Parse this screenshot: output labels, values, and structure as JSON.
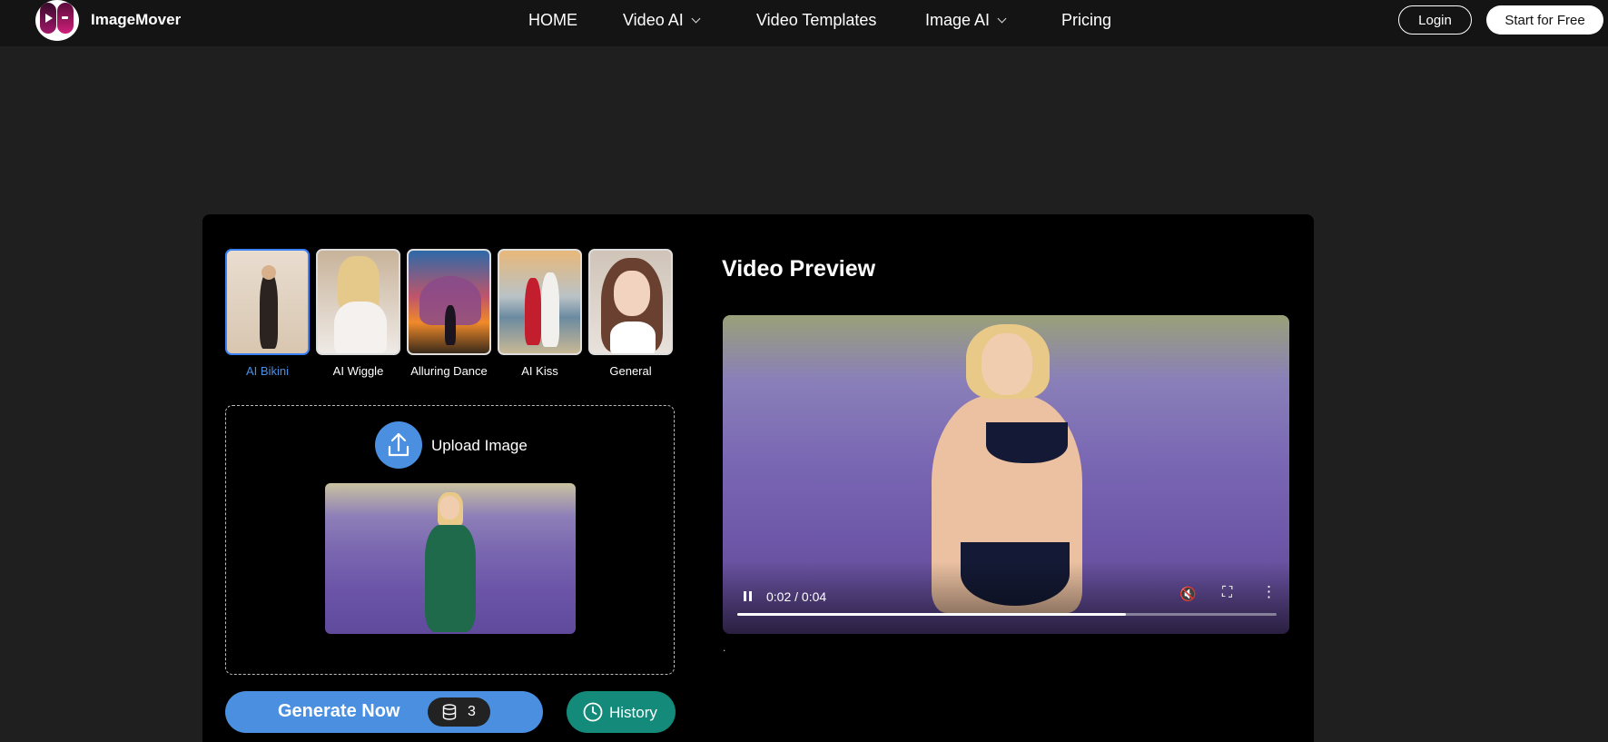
{
  "header": {
    "brand": "ImageMover",
    "nav": [
      {
        "label": "HOME",
        "has_dropdown": false
      },
      {
        "label": "Video AI",
        "has_dropdown": true
      },
      {
        "label": "Video Templates",
        "has_dropdown": false
      },
      {
        "label": "Image AI",
        "has_dropdown": true
      },
      {
        "label": "Pricing",
        "has_dropdown": false
      }
    ],
    "login_label": "Login",
    "start_label": "Start for Free"
  },
  "templates": [
    {
      "label": "AI Bikini",
      "active": true
    },
    {
      "label": "AI Wiggle",
      "active": false
    },
    {
      "label": "Alluring Dance",
      "active": false
    },
    {
      "label": "AI Kiss",
      "active": false
    },
    {
      "label": "General",
      "active": false
    }
  ],
  "upload": {
    "label": "Upload Image"
  },
  "generate": {
    "label": "Generate Now",
    "credits": "3"
  },
  "history": {
    "label": "History"
  },
  "preview": {
    "title": "Video Preview",
    "time": "0:02 / 0:04",
    "progress": 0.72,
    "caption": "."
  },
  "colors": {
    "accent": "#4a8fe0",
    "history": "#138a7a",
    "page_bg": "#1f1f1f",
    "panel_bg": "#000000"
  }
}
